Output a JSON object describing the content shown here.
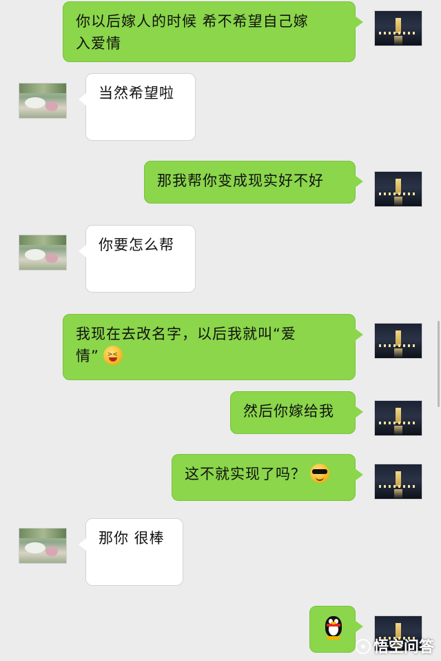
{
  "messages": [
    {
      "side": "me",
      "text_lines": [
        "你以后嫁人的时候  希不希望自己嫁",
        "入爱情"
      ]
    },
    {
      "side": "them",
      "text": "当然希望啦"
    },
    {
      "side": "me",
      "text": "那我帮你变成现实好不好"
    },
    {
      "side": "them",
      "text": "你要怎么帮"
    },
    {
      "side": "me",
      "text_lines": [
        "我现在去改名字，以后我就叫“爱",
        "情”"
      ],
      "emoji": "grin-emoji"
    },
    {
      "side": "me",
      "text": "然后你嫁给我"
    },
    {
      "side": "me",
      "text": "这不就实现了吗？",
      "emoji": "sunglasses-emoji"
    },
    {
      "side": "them",
      "text": "那你 很棒"
    },
    {
      "side": "me",
      "sticker": "qq-penguin-sticker"
    }
  ],
  "watermark": {
    "text": "悟空问答"
  },
  "colors": {
    "my_bubble": "#8bd64b",
    "their_bubble": "#ffffff",
    "background": "#ececec"
  }
}
